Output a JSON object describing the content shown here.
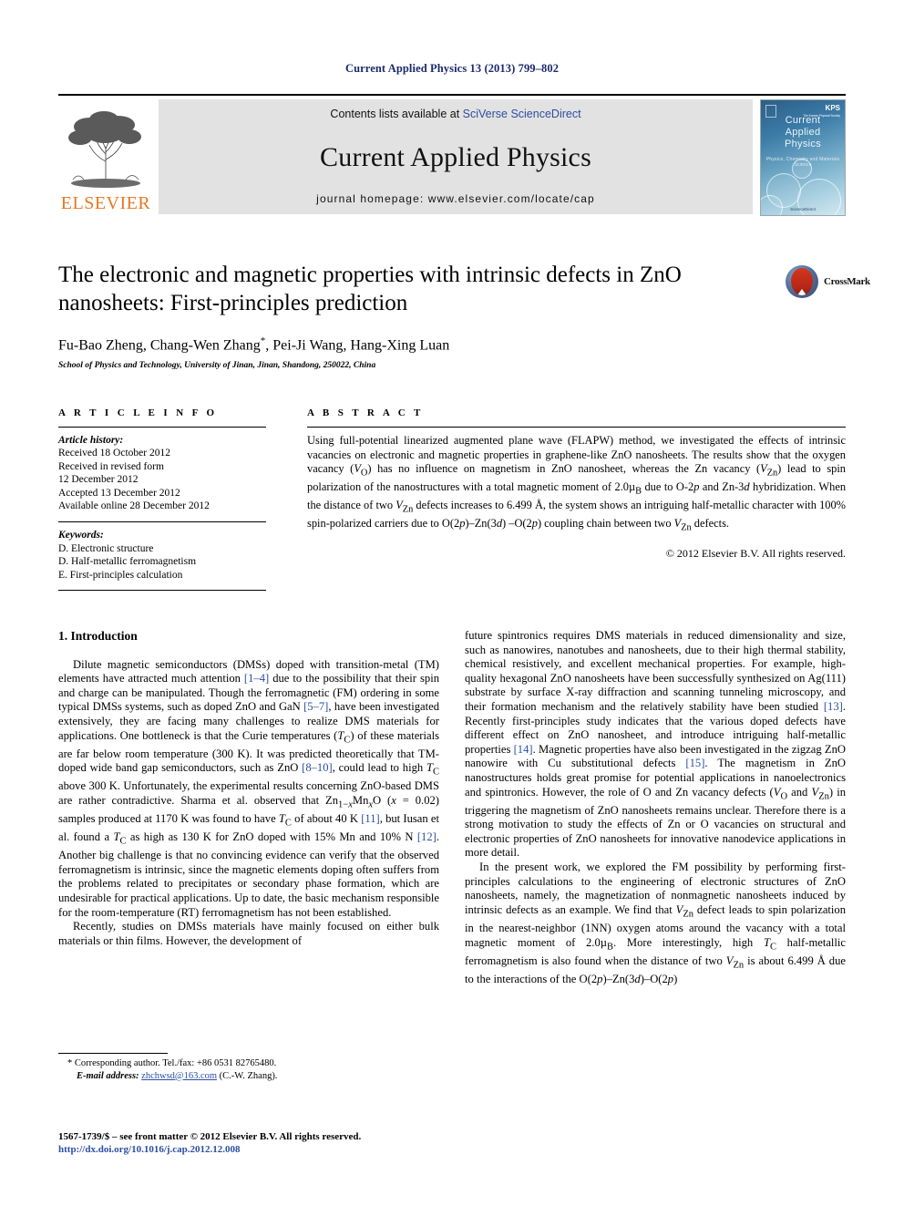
{
  "running_head": "Current Applied Physics 13 (2013) 799–802",
  "masthead": {
    "contents_prefix": "Contents lists available at ",
    "contents_link": "SciVerse ScienceDirect",
    "journal_title": "Current Applied Physics",
    "homepage": "journal homepage: www.elsevier.com/locate/cap",
    "publisher_name": "ELSEVIER",
    "cover": {
      "title_line1": "Current",
      "title_line2": "Applied",
      "title_line3": "Physics",
      "subtitle": "Physics, Chemistry and Materials Science",
      "society": "KPS",
      "society_sub": "The Korean Physical Society",
      "footer": "ScienceDirect"
    }
  },
  "article": {
    "title": "The electronic and magnetic properties with intrinsic defects in ZnO nanosheets: First-principles prediction",
    "authors": "Fu-Bao Zheng, Chang-Wen Zhang",
    "authors_star": "*",
    "authors_rest": ", Pei-Ji Wang, Hang-Xing Luan",
    "affiliation": "School of Physics and Technology, University of Jinan, Jinan, Shandong, 250022, China",
    "crossmark_label": "CrossMark"
  },
  "article_info": {
    "heading": "A R T I C L E  I N F O",
    "history_label": "Article history:",
    "history": [
      "Received 18 October 2012",
      "Received in revised form",
      "12 December 2012",
      "Accepted 13 December 2012",
      "Available online 28 December 2012"
    ],
    "keywords_label": "Keywords:",
    "keywords": [
      "D. Electronic structure",
      "D. Half-metallic ferromagnetism",
      "E. First-principles calculation"
    ]
  },
  "abstract": {
    "heading": "A B S T R A C T",
    "text": "Using full-potential linearized augmented plane wave (FLAPW) method, we investigated the effects of intrinsic vacancies on electronic and magnetic properties in graphene-like ZnO nanosheets. The results show that the oxygen vacancy (VO) has no influence on magnetism in ZnO nanosheet, whereas the Zn vacancy (VZn) lead to spin polarization of the nanostructures with a total magnetic moment of 2.0μB due to O-2p and Zn-3d hybridization. When the distance of two VZn defects increases to 6.499 Å, the system shows an intriguing half-metallic character with 100% spin-polarized carriers due to O(2p)–Zn(3d)–O(2p) coupling chain between two VZn defects.",
    "copyright": "© 2012 Elsevier B.V. All rights reserved."
  },
  "body": {
    "section_number_title": "1. Introduction",
    "left_paragraphs": [
      "Dilute magnetic semiconductors (DMSs) doped with transition-metal (TM) elements have attracted much attention [1–4] due to the possibility that their spin and charge can be manipulated. Though the ferromagnetic (FM) ordering in some typical DMSs systems, such as doped ZnO and GaN [5–7], have been investigated extensively, they are facing many challenges to realize DMS materials for applications. One bottleneck is that the Curie temperatures (TC) of these materials are far below room temperature (300 K). It was predicted theoretically that TM-doped wide band gap semiconductors, such as ZnO [8–10], could lead to high TC above 300 K. Unfortunately, the experimental results concerning ZnO-based DMS are rather contradictive. Sharma et al. observed that Zn1−xMnxO (x = 0.02) samples produced at 1170 K was found to have TC of about 40 K [11], but Iusan et al. found a TC as high as 130 K for ZnO doped with 15% Mn and 10% N [12]. Another big challenge is that no convincing evidence can verify that the observed ferromagnetism is intrinsic, since the magnetic elements doping often suffers from the problems related to precipitates or secondary phase formation, which are undesirable for practical applications. Up to date, the basic mechanism responsible for the room-temperature (RT) ferromagnetism has not been established.",
      "Recently, studies on DMSs materials have mainly focused on either bulk materials or thin films. However, the development of"
    ],
    "right_paragraphs": [
      "future spintronics requires DMS materials in reduced dimensionality and size, such as nanowires, nanotubes and nanosheets, due to their high thermal stability, chemical resistively, and excellent mechanical properties. For example, high-quality hexagonal ZnO nanosheets have been successfully synthesized on Ag(111) substrate by surface X-ray diffraction and scanning tunneling microscopy, and their formation mechanism and the relatively stability have been studied [13]. Recently first-principles study indicates that the various doped defects have different effect on ZnO nanosheet, and introduce intriguing half-metallic properties [14]. Magnetic properties have also been investigated in the zigzag ZnO nanowire with Cu substitutional defects [15]. The magnetism in ZnO nanostructures holds great promise for potential applications in nanoelectronics and spintronics. However, the role of O and Zn vacancy defects (VO and VZn) in triggering the magnetism of ZnO nanosheets remains unclear. Therefore there is a strong motivation to study the effects of Zn or O vacancies on structural and electronic properties of ZnO nanosheets for innovative nanodevice applications in more detail.",
      "In the present work, we explored the FM possibility by performing first-principles calculations to the engineering of electronic structures of ZnO nanosheets, namely, the magnetization of nonmagnetic nanosheets induced by intrinsic defects as an example. We find that VZn defect leads to spin polarization in the nearest-neighbor (1NN) oxygen atoms around the vacancy with a total magnetic moment of 2.0μB. More interestingly, high TC half-metallic ferromagnetism is also found when the distance of two VZn is about 6.499 Å due to the interactions of the O(2p)–Zn(3d)–O(2p)"
    ]
  },
  "footnotes": {
    "corresponding": "* Corresponding author. Tel./fax: +86 0531 82765480.",
    "email_label": "E-mail address:",
    "email": "zhchwsd@163.com",
    "email_suffix": " (C.-W. Zhang)."
  },
  "imprint": {
    "line1": "1567-1739/$ – see front matter © 2012 Elsevier B.V. All rights reserved.",
    "doi": "http://dx.doi.org/10.1016/j.cap.2012.12.008"
  },
  "colors": {
    "link": "#2b4ea2",
    "runhead": "#1b2a6b",
    "elsevier_orange": "#e87722",
    "banner_bg": "#e2e2e2"
  }
}
